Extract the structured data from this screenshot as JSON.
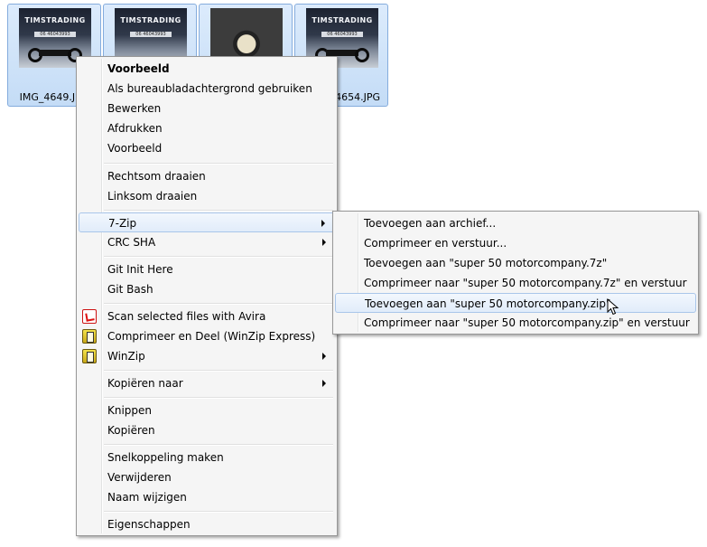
{
  "thumbnails": [
    {
      "brand": "TIMSTRADING",
      "phone": "06 46043993",
      "label": "IMG_4649.JPG"
    },
    {
      "brand": "TIMSTRADING",
      "phone": "06 46043993",
      "label": ""
    },
    {
      "brand": "",
      "phone": "",
      "label": ""
    },
    {
      "brand": "TIMSTRADING",
      "phone": "06 46043993",
      "label": "IMG_4654.JPG"
    }
  ],
  "context_menu": {
    "items": [
      {
        "label": "Voorbeeld"
      },
      {
        "label": "Als bureaubladachtergrond gebruiken"
      },
      {
        "label": "Bewerken"
      },
      {
        "label": "Afdrukken"
      },
      {
        "label": "Voorbeeld"
      },
      {
        "label": "Rechtsom draaien"
      },
      {
        "label": "Linksom draaien"
      },
      {
        "label": "7-Zip"
      },
      {
        "label": "CRC SHA"
      },
      {
        "label": "Git Init Here"
      },
      {
        "label": "Git Bash"
      },
      {
        "label": "Scan selected files with Avira",
        "icon": "avira-icon"
      },
      {
        "label": "Comprimeer en Deel (WinZip Express)",
        "icon": "winzip-icon"
      },
      {
        "label": "WinZip",
        "icon": "winzip-icon"
      },
      {
        "label": "Kopiëren naar"
      },
      {
        "label": "Knippen"
      },
      {
        "label": "Kopiëren"
      },
      {
        "label": "Snelkoppeling maken"
      },
      {
        "label": "Verwijderen"
      },
      {
        "label": "Naam wijzigen"
      },
      {
        "label": "Eigenschappen"
      }
    ]
  },
  "submenu_7zip": {
    "items": [
      {
        "label": "Toevoegen aan archief..."
      },
      {
        "label": "Comprimeer en verstuur..."
      },
      {
        "label": "Toevoegen aan \"super 50 motorcompany.7z\""
      },
      {
        "label": "Comprimeer naar \"super 50 motorcompany.7z\" en verstuur"
      },
      {
        "label": "Toevoegen aan \"super 50 motorcompany.zip\""
      },
      {
        "label": "Comprimeer naar \"super 50 motorcompany.zip\" en verstuur"
      }
    ]
  },
  "colors": {
    "highlight_border": "#a9c6ea",
    "menu_background": "#f5f5f5",
    "selection_border": "#84acdd"
  }
}
